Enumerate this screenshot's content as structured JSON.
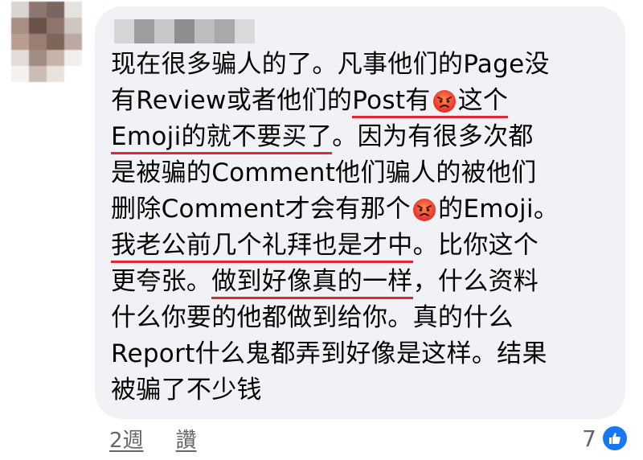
{
  "comment": {
    "lines": [
      {
        "segments": [
          "现在很多骗人的了。凡事他们的Page没"
        ]
      },
      {
        "segments": [
          "有Review或者他们的",
          "Post有",
          "这个"
        ]
      },
      {
        "segments": [
          "Emoji的就不要买了",
          "。因为有很多次都"
        ]
      },
      {
        "segments": [
          "是被骗的Comment他们骗人的被他们"
        ]
      },
      {
        "segments": [
          "删除Comment才会有那个",
          "的Emoji。"
        ]
      },
      {
        "segments": [
          "我老公前几个礼拜也是才中",
          "。比你这个"
        ]
      },
      {
        "segments": [
          "更夸张。",
          "做到好像真的一样",
          "，什么资料"
        ]
      },
      {
        "segments": [
          "什么你要的他都做到给你。真的什么"
        ]
      },
      {
        "segments": [
          "Report什么鬼都弄到好像是这样。结果"
        ]
      },
      {
        "segments": [
          "被骗了不少钱"
        ]
      }
    ],
    "emoji_name": "angry-face-emoji"
  },
  "footer": {
    "timestamp": "2週",
    "like_action": "讚"
  },
  "reactions": {
    "count": "7",
    "icon": "thumbs-up-icon"
  },
  "colors": {
    "bubble": "#f0f2f5",
    "text": "#050505",
    "meta": "#65676b",
    "underline": "#e0282e",
    "like": "#1877f2"
  }
}
